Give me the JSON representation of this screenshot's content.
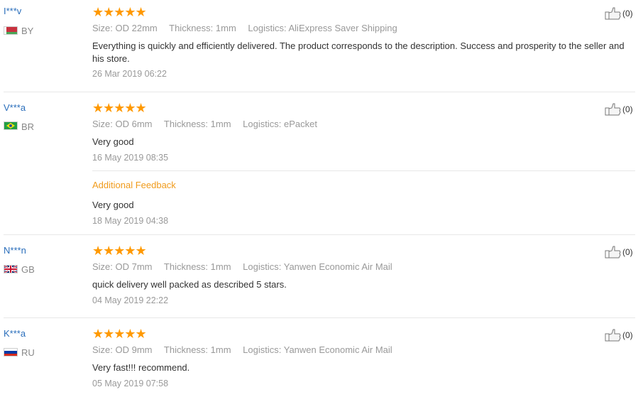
{
  "reviews": [
    {
      "user": "I***v",
      "country": "BY",
      "stars": "★★★★★",
      "size": "Size: OD 22mm",
      "thickness": "Thickness: 1mm",
      "logistics": "Logistics: AliExpress Saver Shipping",
      "text": "Everything is quickly and efficiently delivered. The product corresponds to the description. Success and prosperity to the seller and his store.",
      "date": "26 Mar 2019 06:22",
      "helpful": "(0)"
    },
    {
      "user": "V***a",
      "country": "BR",
      "stars": "★★★★★",
      "size": "Size: OD 6mm",
      "thickness": "Thickness: 1mm",
      "logistics": "Logistics: ePacket",
      "text": "Very good",
      "date": "16 May 2019 08:35",
      "helpful": "(0)",
      "additional_label": "Additional Feedback",
      "additional_text": "Very good",
      "additional_date": "18 May 2019 04:38"
    },
    {
      "user": "N***n",
      "country": "GB",
      "stars": "★★★★★",
      "size": "Size: OD 7mm",
      "thickness": "Thickness: 1mm",
      "logistics": "Logistics: Yanwen Economic Air Mail",
      "text": "quick delivery well packed as described 5 stars.",
      "date": "04 May 2019 22:22",
      "helpful": "(0)"
    },
    {
      "user": "K***a",
      "country": "RU",
      "stars": "★★★★★",
      "size": "Size: OD 9mm",
      "thickness": "Thickness: 1mm",
      "logistics": "Logistics: Yanwen Economic Air Mail",
      "text": "Very fast!!! recommend.",
      "date": "05 May 2019 07:58",
      "helpful": "(0)"
    }
  ],
  "colors": {
    "username": "#2a6ebb",
    "star": "#ff9900",
    "additional": "#f09b1c",
    "muted": "#999999"
  },
  "icons": {
    "helpful": "thumbs-up-icon",
    "rating": "star-icon"
  }
}
